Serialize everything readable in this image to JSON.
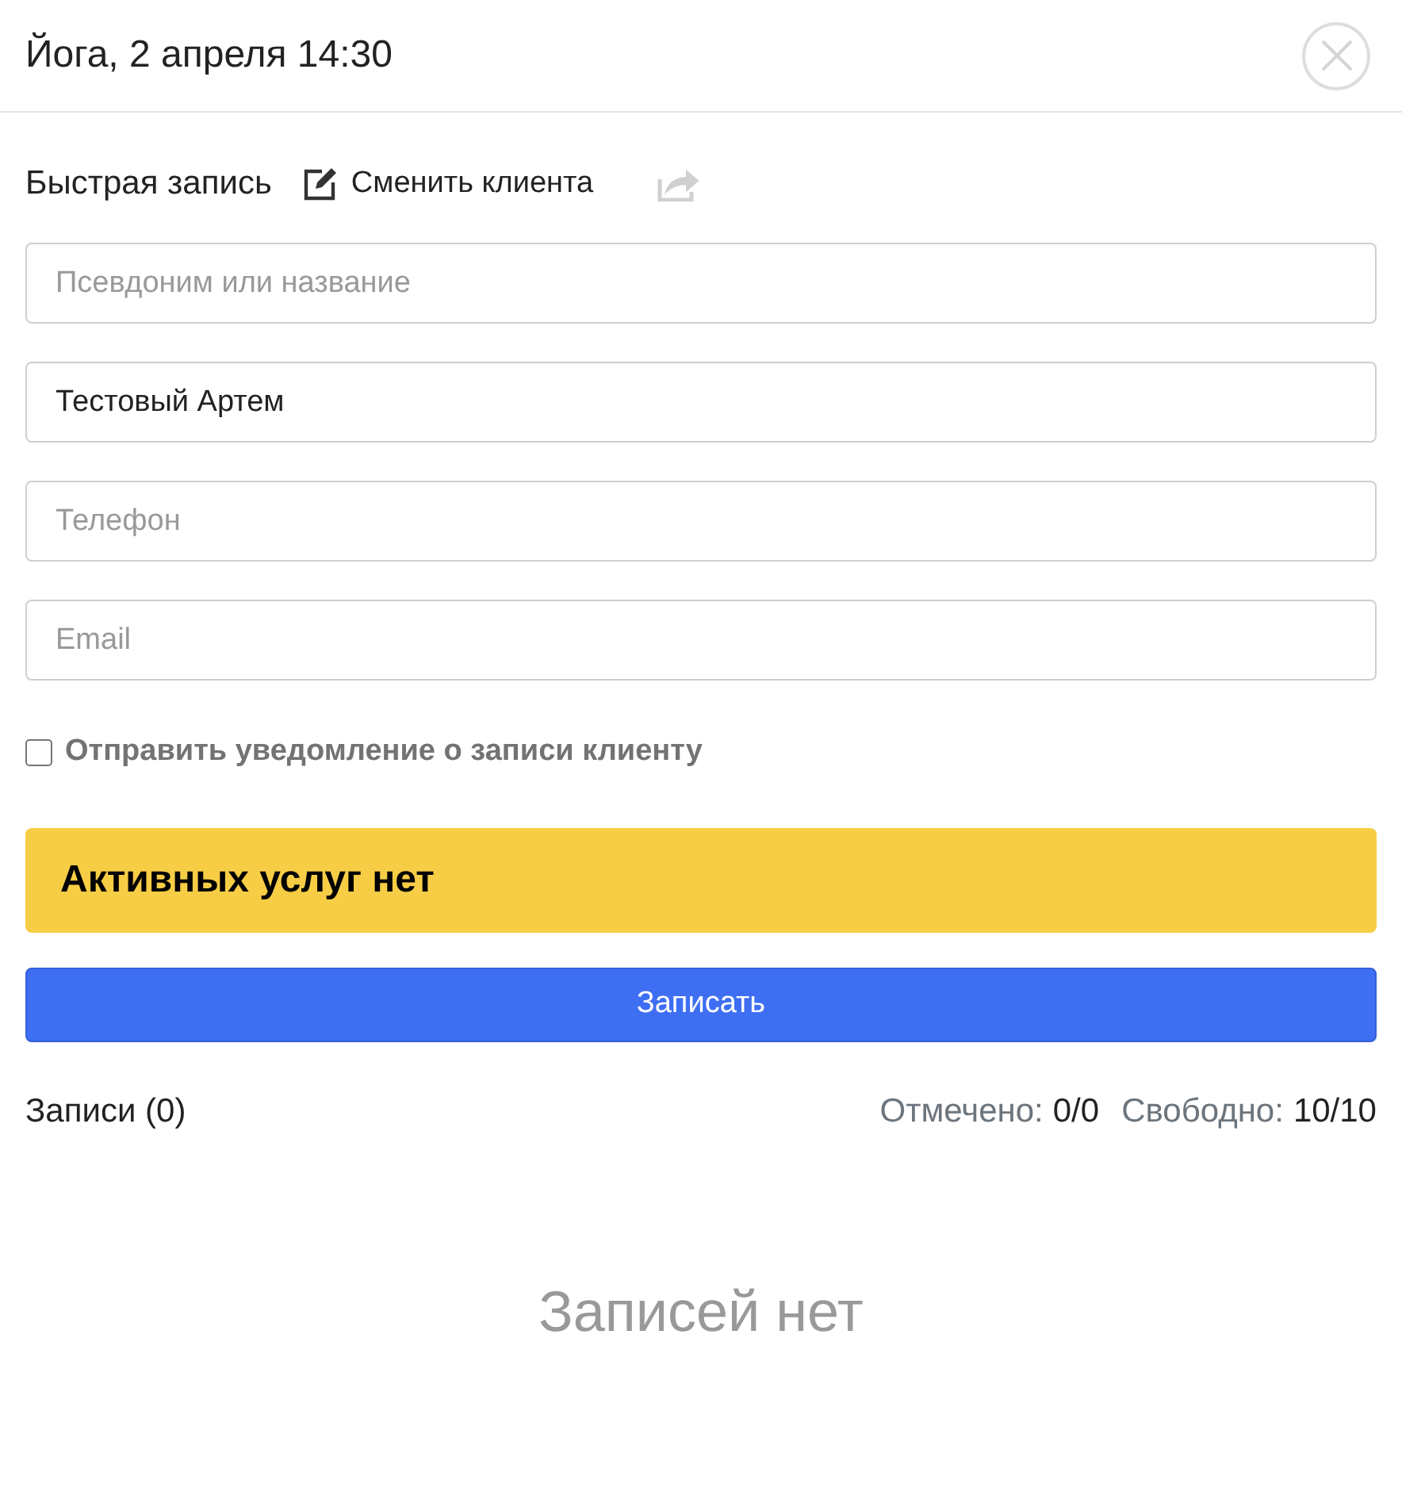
{
  "header": {
    "title": "Йога, 2 апреля 14:30"
  },
  "toolbar": {
    "quick_entry": "Быстрая запись",
    "change_client": "Сменить клиента",
    "share": {
      "disabled": true
    }
  },
  "fields": [
    {
      "placeholder": "Псевдоним или название"
    },
    {
      "value": "Тестовый Артем"
    },
    {
      "placeholder": "Телефон"
    },
    {
      "placeholder": "Email"
    }
  ],
  "notify": {
    "label": "Отправить уведомление о записи клиенту",
    "checked": false
  },
  "alert": {
    "text": "Активных услуг нет"
  },
  "submit_button": "Записать",
  "summary": {
    "entries": "Записи (0)",
    "marked_label": "Отмечено:",
    "marked_value": "0/0",
    "free_label": "Свободно:",
    "free_value": "10/10"
  },
  "empty_message": "Записей нет"
}
